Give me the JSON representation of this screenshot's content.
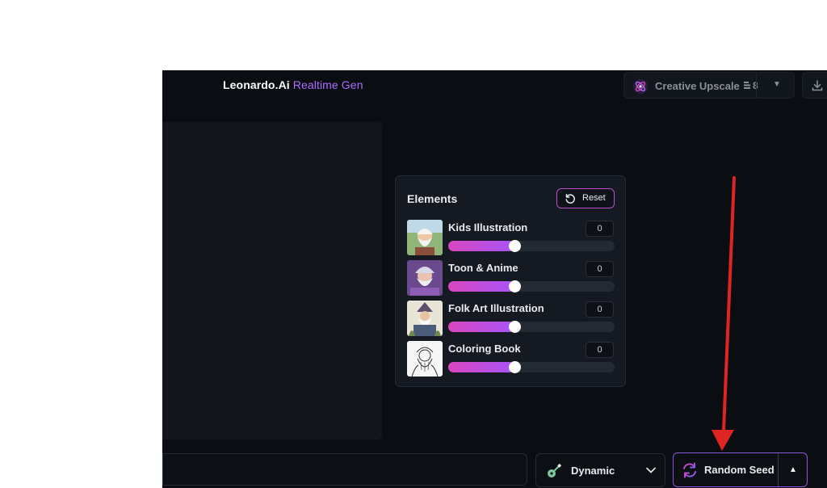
{
  "header": {
    "brand_name": "Leonardo.Ai",
    "brand_product": "Realtime Gen",
    "upscale_label": "Creative Upscale",
    "upscale_cost": "8",
    "download_icon": "download-icon"
  },
  "elements_panel": {
    "title": "Elements",
    "reset_label": "Reset",
    "items": [
      {
        "label": "Kids Illustration",
        "value": "0",
        "level": 0.4
      },
      {
        "label": "Toon & Anime",
        "value": "0",
        "level": 0.4
      },
      {
        "label": "Folk Art Illustration",
        "value": "0",
        "level": 0.4
      },
      {
        "label": "Coloring Book",
        "value": "0",
        "level": 0.4
      }
    ]
  },
  "bottom_bar": {
    "style_label": "Dynamic",
    "seed_label": "Random Seed"
  },
  "colors": {
    "accent": "#a855f7",
    "slider_start": "#d946c0",
    "annotation_arrow": "#e02424"
  }
}
